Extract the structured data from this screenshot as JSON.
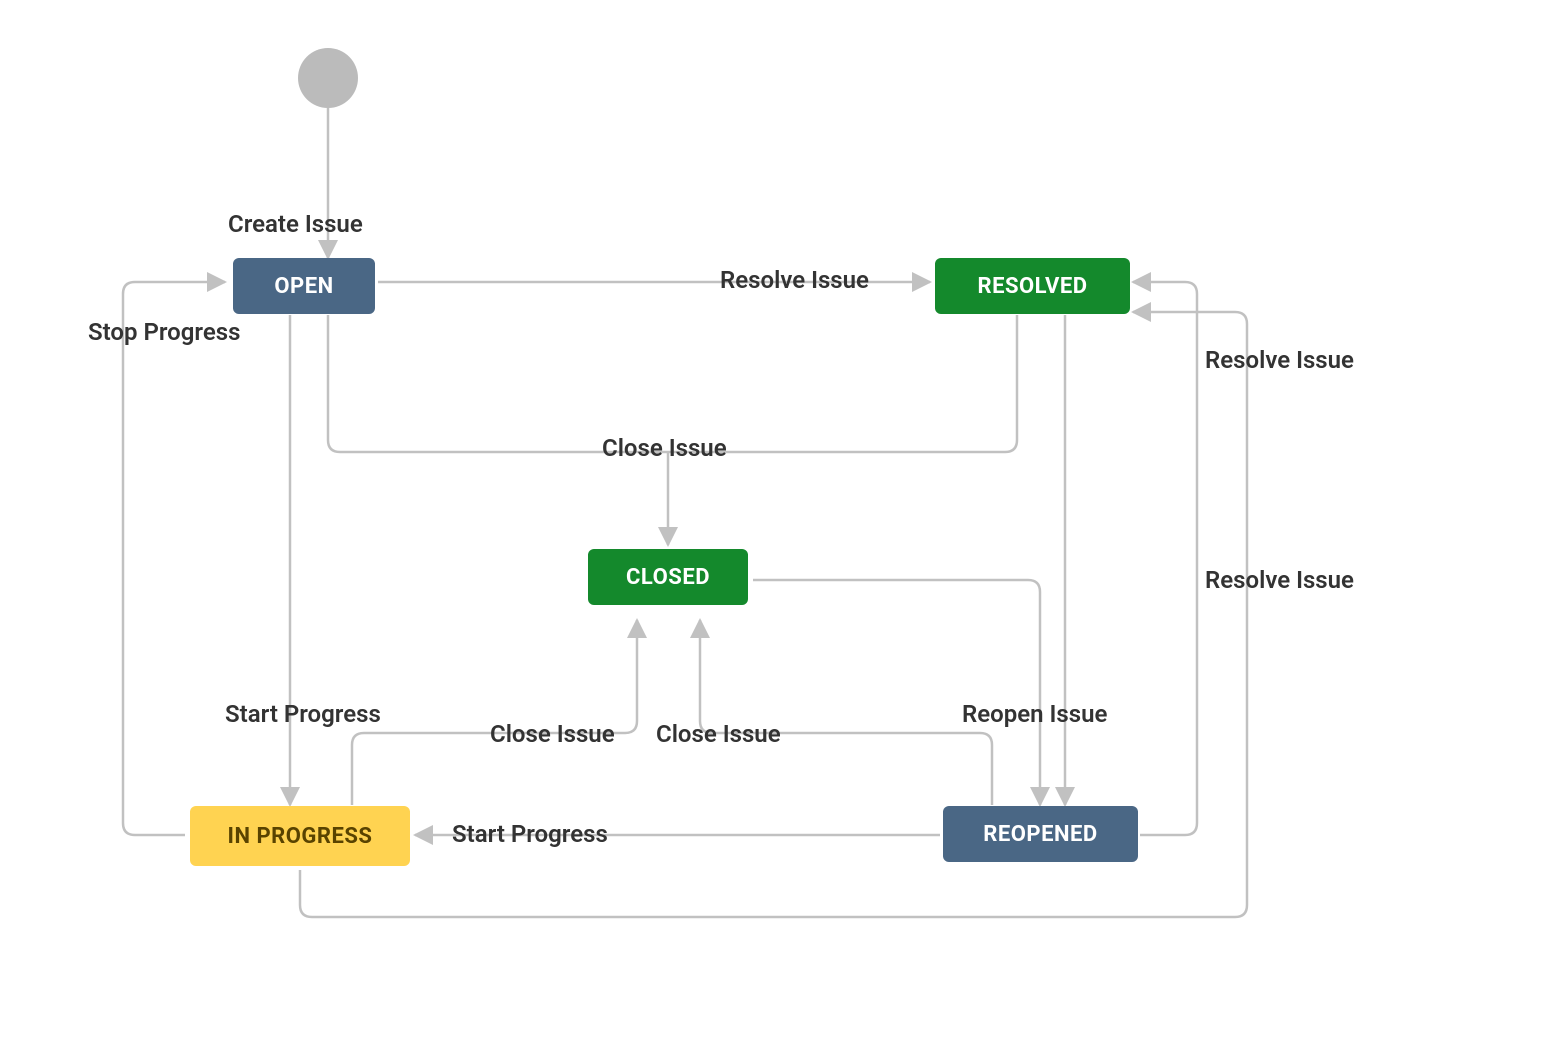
{
  "states": {
    "open": {
      "text": "OPEN"
    },
    "resolved": {
      "text": "RESOLVED"
    },
    "closed": {
      "text": "CLOSED"
    },
    "inprogress": {
      "text": "IN PROGRESS"
    },
    "reopened": {
      "text": "REOPENED"
    }
  },
  "transitions": {
    "create_issue": "Create Issue",
    "stop_progress": "Stop Progress",
    "open_resolve": "Resolve Issue",
    "resolve_issue_right_upper": "Resolve Issue",
    "resolve_issue_right_lower": "Resolve Issue",
    "close_issue_top": "Close Issue",
    "close_issue_left": "Close Issue",
    "close_issue_right": "Close Issue",
    "reopen_issue": "Reopen Issue",
    "start_progress_left": "Start Progress",
    "start_progress_mid": "Start Progress"
  },
  "colors": {
    "line": "#c1c1c1",
    "text": "#333333",
    "blue": "#4a6785",
    "green": "#14892c",
    "yellow_bg": "#ffd351",
    "yellow_text": "#594300",
    "start_node": "#bbbbbb"
  }
}
